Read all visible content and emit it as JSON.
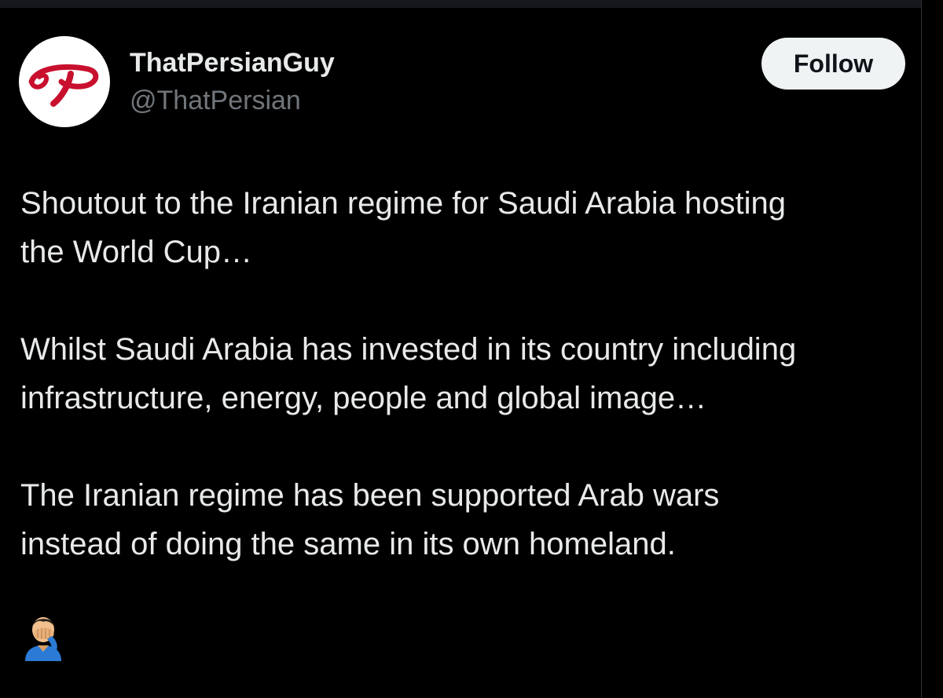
{
  "author": {
    "display_name": "ThatPersianGuy",
    "handle": "@ThatPersian",
    "avatar_icon": "red-script-p-logo",
    "avatar_accent": "#c8102e"
  },
  "actions": {
    "follow_label": "Follow"
  },
  "tweet": {
    "paragraphs": [
      "Shoutout to the Iranian regime for Saudi Arabia hosting\nthe World Cup…",
      "Whilst Saudi Arabia has invested in its country including\ninfrastructure, energy, people and global image…",
      "The Iranian regime has been supported Arab wars\ninstead of doing the same in its own homeland."
    ],
    "emoji_icon": "man-facepalming-emoji"
  },
  "colors": {
    "background": "#000000",
    "text_primary": "#e7e9ea",
    "text_secondary": "#71767b",
    "button_bg": "#eff3f4",
    "button_text": "#0f1419"
  }
}
